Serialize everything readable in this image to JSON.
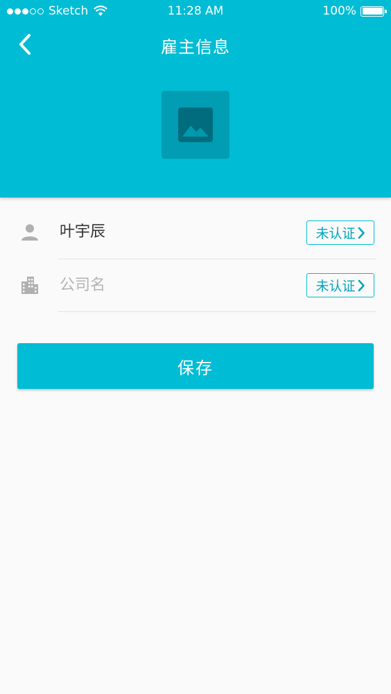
{
  "status_bar": {
    "carrier": "Sketch",
    "time": "11:28 AM",
    "battery": "100%"
  },
  "header": {
    "title": "雇主信息",
    "back_icon": "chevron-left-icon",
    "avatar_icon": "image-placeholder-icon"
  },
  "form": {
    "name": {
      "icon": "person-icon",
      "value": "叶宇辰",
      "badge": "未认证"
    },
    "company": {
      "icon": "building-icon",
      "placeholder": "公司名",
      "badge": "未认证"
    }
  },
  "actions": {
    "save_label": "保存"
  },
  "colors": {
    "primary": "#00bcd4",
    "avatar_bg": "#009db3",
    "background": "#fafafa",
    "icon_gray": "#b0b0b0"
  }
}
